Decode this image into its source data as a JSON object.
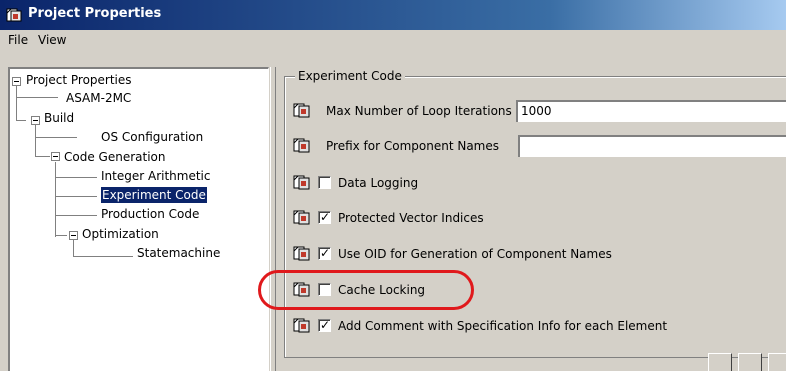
{
  "window": {
    "title": "Project Properties"
  },
  "menu": {
    "items": [
      "File",
      "View"
    ]
  },
  "tree": {
    "items": [
      {
        "label": "Project Properties",
        "selected": false
      },
      {
        "label": "ASAM-2MC",
        "selected": false
      },
      {
        "label": "Build",
        "selected": false
      },
      {
        "label": "OS Configuration",
        "selected": false
      },
      {
        "label": "Code Generation",
        "selected": false
      },
      {
        "label": "Integer Arithmetic",
        "selected": false
      },
      {
        "label": "Experiment Code",
        "selected": true
      },
      {
        "label": "Production Code",
        "selected": false
      },
      {
        "label": "Optimization",
        "selected": false
      },
      {
        "label": "Statemachine",
        "selected": false
      }
    ]
  },
  "group": {
    "title": "Experiment Code",
    "rows": [
      {
        "label": "Max Number of Loop Iterations",
        "type": "text",
        "value": "1000"
      },
      {
        "label": "Prefix for Component Names",
        "type": "text",
        "value": ""
      },
      {
        "label": "Data Logging",
        "type": "checkbox",
        "checked": false
      },
      {
        "label": "Protected Vector Indices",
        "type": "checkbox",
        "checked": true
      },
      {
        "label": "Use OID for Generation of Component Names",
        "type": "checkbox",
        "checked": true
      },
      {
        "label": "Cache Locking",
        "type": "checkbox",
        "checked": false
      },
      {
        "label": "Add Comment with Specification Info for each Element",
        "type": "checkbox",
        "checked": true
      }
    ]
  },
  "colors": {
    "title_bar": "#0a246a",
    "selection": "#0a246a",
    "highlight_ring": "#e0191c",
    "face": "#d4d0c8"
  },
  "icons": {
    "row_icon": "properties-page-icon",
    "title_icon": "properties-icon"
  }
}
